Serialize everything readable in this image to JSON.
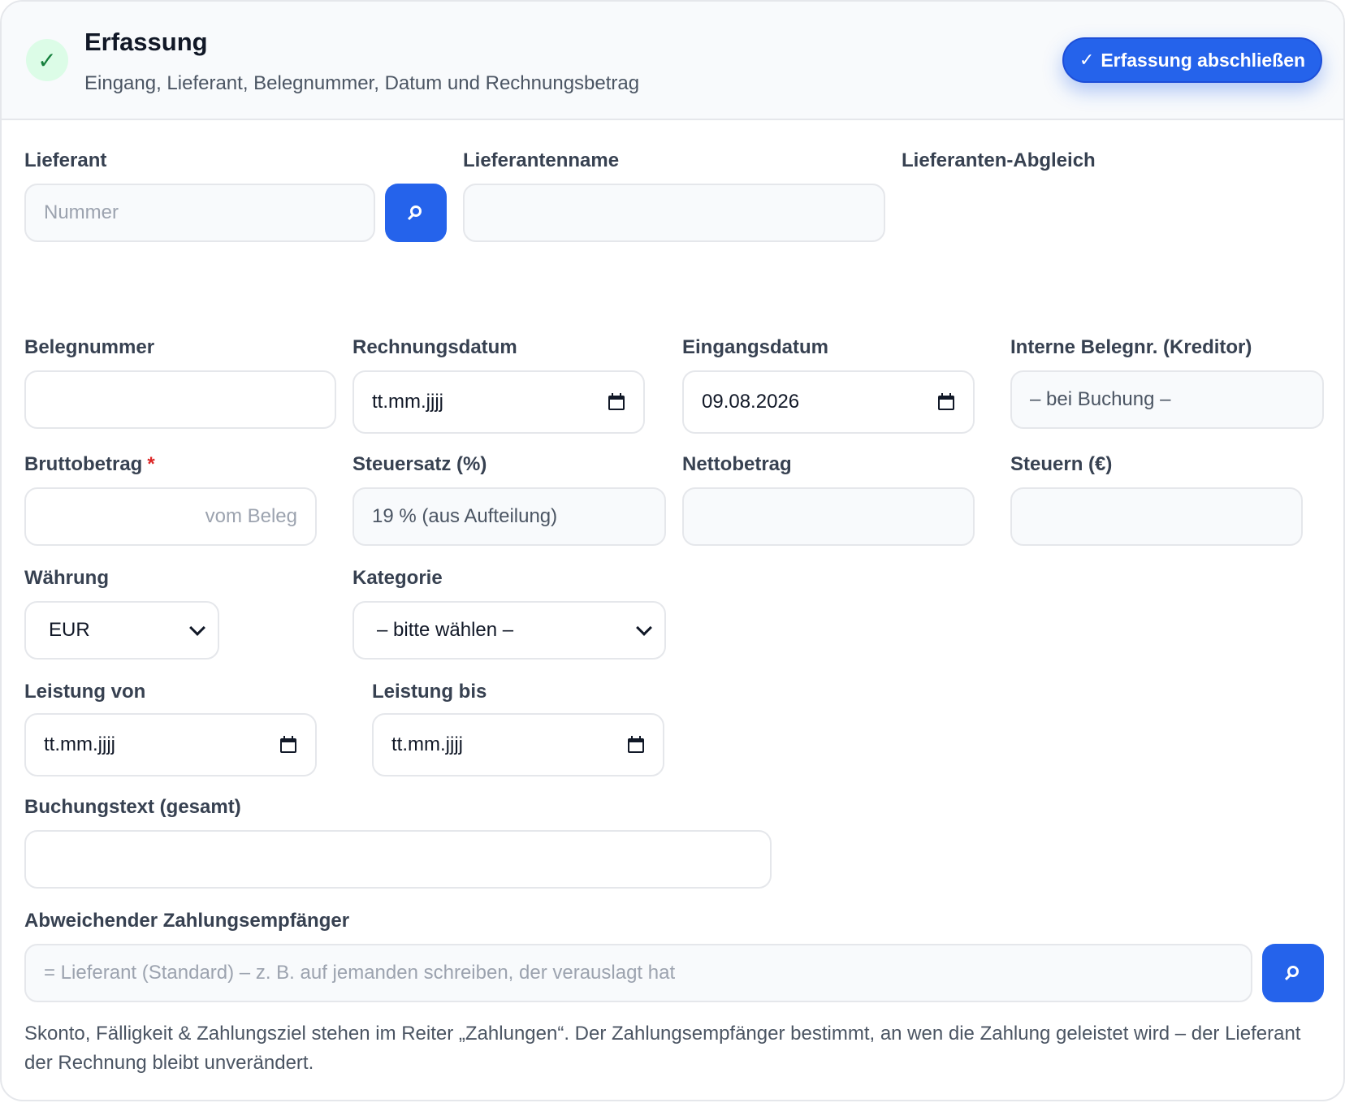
{
  "header": {
    "check_glyph": "✓",
    "title": "Erfassung",
    "subtitle": "Eingang, Lieferant, Belegnummer, Datum und Rechnungsbetrag",
    "finish_glyph": "✓",
    "finish_label": "Erfassung abschließen"
  },
  "supplier": {
    "label": "Lieferant",
    "placeholder": "Nummer",
    "name_label": "Lieferantenname",
    "name_value": "",
    "match_label": "Lieferanten-Abgleich"
  },
  "fields": {
    "belegnummer_label": "Belegnummer",
    "belegnummer_value": "",
    "rechnungsdatum_label": "Rechnungsdatum",
    "rechnungsdatum_value": "tt.mm.jjjj",
    "eingangsdatum_label": "Eingangsdatum",
    "eingangsdatum_value": "09.08.2026",
    "interne_label": "Interne Belegnr. (Kreditor)",
    "interne_value": "– bei Buchung –",
    "brutto_label": "Bruttobetrag",
    "brutto_required": "*",
    "brutto_placeholder": "vom Beleg",
    "steuersatz_label": "Steuersatz (%)",
    "steuersatz_value": "19 % (aus Aufteilung)",
    "netto_label": "Nettobetrag",
    "netto_value": "",
    "steuern_label": "Steuern (€)",
    "steuern_value": "",
    "waehrung_label": "Währung",
    "waehrung_value": "EUR",
    "kategorie_label": "Kategorie",
    "kategorie_value": "– bitte wählen –",
    "leistung_von_label": "Leistung von",
    "leistung_von_value": "tt.mm.jjjj",
    "leistung_bis_label": "Leistung bis",
    "leistung_bis_value": "tt.mm.jjjj",
    "buchungstext_label": "Buchungstext (gesamt)",
    "buchungstext_value": "",
    "zahlungsempfaenger_label": "Abweichender Zahlungsempfänger",
    "zahlungsempfaenger_placeholder": "= Lieferant (Standard) – z. B. auf jemanden schreiben, der verauslagt hat"
  },
  "hint": "Skonto, Fälligkeit & Zahlungsziel stehen im Reiter „Zahlungen“. Der Zahlungsempfänger bestimmt, an wen die Zahlung geleistet wird – der Lieferant der Rechnung bleibt unverändert.",
  "icons": {
    "check": "check-icon",
    "search": "search-icon",
    "calendar": "calendar-icon",
    "dropdown": "chevron-down-icon"
  },
  "colors": {
    "accent": "#2563eb",
    "success_bg": "#dcfce7",
    "success_fg": "#15803d",
    "required": "#dc2626"
  }
}
